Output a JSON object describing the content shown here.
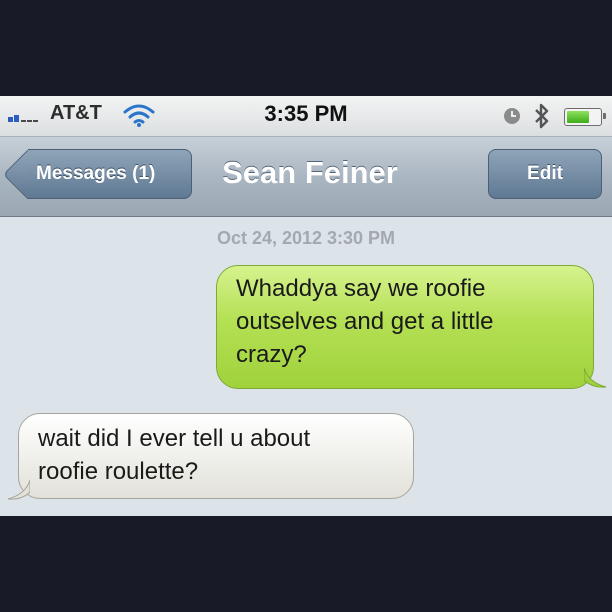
{
  "status_bar": {
    "carrier": "AT&T",
    "time": "3:35 PM",
    "icons": [
      "signal-bars-icon",
      "wifi-icon",
      "alarm-clock-icon",
      "bluetooth-icon",
      "battery-icon"
    ],
    "battery_level": 0.7
  },
  "nav": {
    "back_label": "Messages (1)",
    "title": "Sean Feiner",
    "edit_label": "Edit"
  },
  "thread": {
    "timestamp": "Oct 24, 2012 3:30 PM",
    "messages": [
      {
        "direction": "sent",
        "lines": [
          "Whaddya say we roofie",
          "outselves and get a little",
          "crazy?"
        ]
      },
      {
        "direction": "received",
        "lines": [
          "wait did I ever tell u about",
          "roofie roulette?"
        ]
      }
    ]
  },
  "colors": {
    "sent_bubble": "#b4e054",
    "received_bubble": "#f0f0ec",
    "nav_bar": "#aab6c1",
    "background": "#dde4e9"
  }
}
